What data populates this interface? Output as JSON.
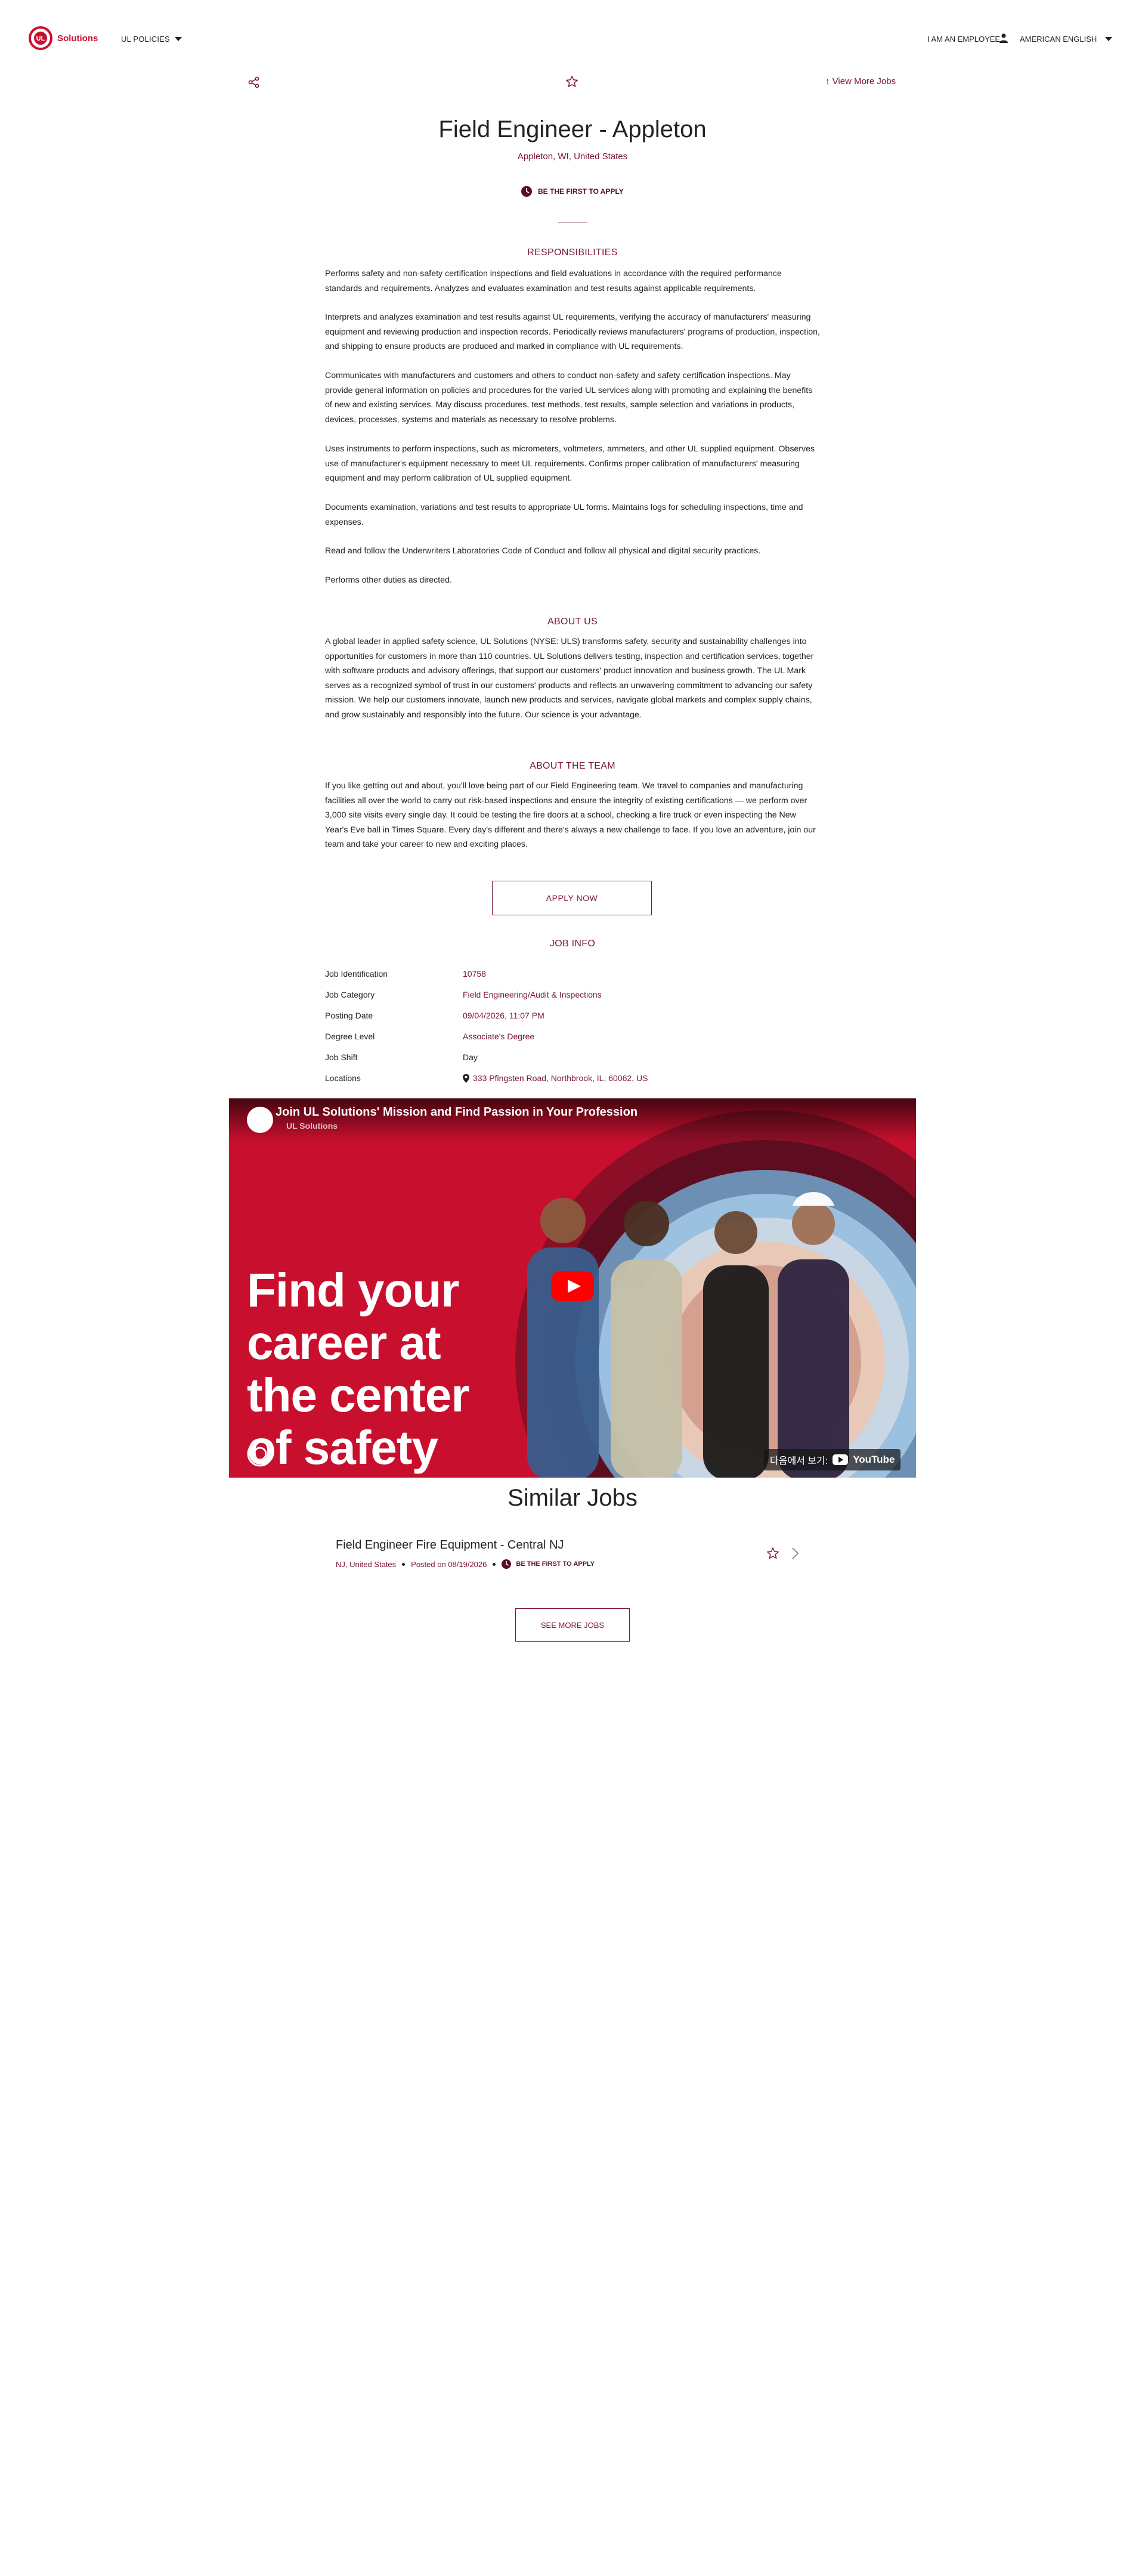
{
  "header": {
    "logo_text": "Solutions",
    "policies_label": "UL POLICIES",
    "employee_label": "I AM AN EMPLOYEE",
    "language_label": "AMERICAN ENGLISH"
  },
  "actions": {
    "view_more_label": "View More Jobs"
  },
  "job": {
    "title": "Field Engineer - Appleton",
    "location": "Appleton, WI, United States",
    "first_to_apply": "BE THE FIRST TO APPLY"
  },
  "sections": {
    "responsibilities_heading": "RESPONSIBILITIES",
    "responsibilities": [
      "Performs safety and non-safety certification inspections and field evaluations in accordance with the required performance standards and requirements. Analyzes and evaluates examination and test results against applicable requirements.",
      "Interprets and analyzes examination and test results against UL requirements, verifying the accuracy of manufacturers' measuring equipment and reviewing production and inspection records. Periodically reviews manufacturers' programs of production, inspection, and shipping to ensure products are produced and marked in compliance with UL requirements.",
      "Communicates with manufacturers and customers and others to conduct non-safety and safety certification inspections. May provide general information on policies and procedures for the varied UL services along with promoting and explaining the benefits of new and existing services. May discuss procedures, test methods, test results, sample selection and variations in products, devices, processes, systems and materials as necessary to resolve problems.",
      "Uses instruments to perform inspections, such as micrometers, voltmeters, ammeters, and other UL supplied equipment. Observes use of manufacturer's equipment necessary to meet UL requirements. Confirms proper calibration of manufacturers' measuring equipment and may perform calibration of UL supplied equipment.",
      "Documents examination, variations and test results to appropriate UL forms. Maintains logs for scheduling inspections, time and expenses.",
      "Read and follow the Underwriters Laboratories Code of Conduct and follow all physical and digital security practices.",
      "Performs other duties as directed."
    ],
    "about_us_heading": "ABOUT US",
    "about_us": "A global leader in applied safety science, UL Solutions (NYSE: ULS) transforms safety, security and sustainability challenges into opportunities for customers in more than 110 countries. UL Solutions delivers testing, inspection and certification services, together with software products and advisory offerings, that support our customers' product innovation and business growth. The UL Mark serves as a recognized symbol of trust in our customers' products and reflects an unwavering commitment to advancing our safety mission. We help our customers innovate, launch new products and services, navigate global markets and complex supply chains, and grow sustainably and responsibly into the future. Our science is your advantage.",
    "about_team_heading": "ABOUT THE TEAM",
    "about_team": "If you like getting out and about, you'll love being part of our Field Engineering team. We travel to companies and manufacturing facilities all over the world to carry out risk-based inspections and ensure the integrity of existing certifications — we perform over 3,000 site visits every single day. It could be testing the fire doors at a school, checking a fire truck or even inspecting the New Year's Eve ball in Times Square. Every day's different and there's always a new challenge to face. If you love an adventure, join our team and take your career to new and exciting places."
  },
  "apply_label": "APPLY NOW",
  "job_info": {
    "heading": "JOB INFO",
    "rows": [
      {
        "label": "Job Identification",
        "value": "10758"
      },
      {
        "label": "Job Category",
        "value": "Field Engineering/Audit & Inspections"
      },
      {
        "label": "Posting Date",
        "value": "09/04/2026, 11:07 PM"
      },
      {
        "label": "Degree Level",
        "value": "Associate's Degree"
      },
      {
        "label": "Job Shift",
        "value": "Day"
      },
      {
        "label": "Locations",
        "value": "333 Pfingsten Road, Northbrook, IL, 60062, US"
      }
    ]
  },
  "video": {
    "title": "Join UL Solutions' Mission and Find Passion in Your Profession",
    "channel": "UL Solutions",
    "hero_lines": [
      "Find your",
      "career at",
      "the center",
      "of safety"
    ],
    "watch_on": "다음에서 보기:",
    "youtube": "YouTube"
  },
  "similar": {
    "heading": "Similar Jobs",
    "jobs": [
      {
        "title": "Field Engineer Fire Equipment - Central NJ",
        "location": "NJ, United States",
        "posted": "Posted on 08/19/2026",
        "badge": "BE THE FIRST TO APPLY"
      }
    ],
    "see_more_label": "SEE MORE JOBS"
  },
  "colors": {
    "accent": "#7a1631",
    "brand_red": "#c8102e"
  }
}
